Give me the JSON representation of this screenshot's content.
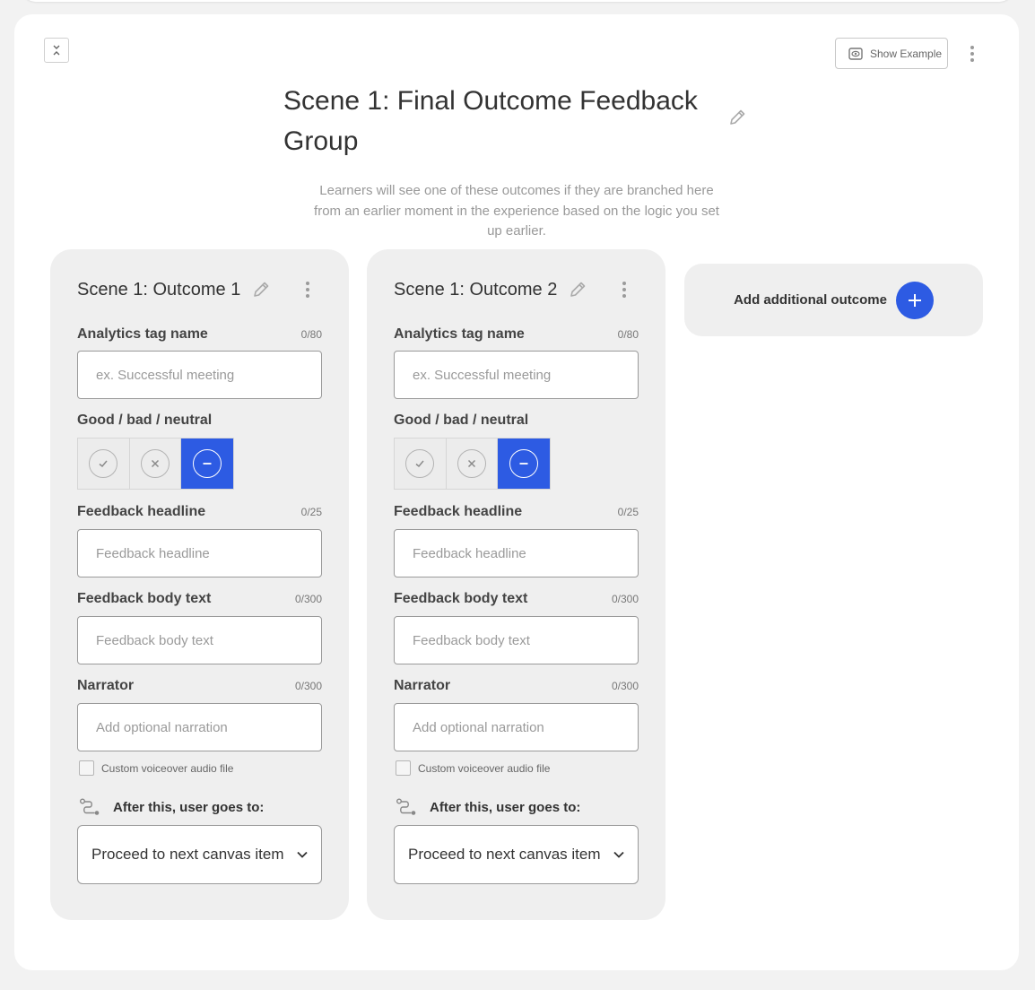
{
  "header": {
    "title": "Scene 1: Final Outcome Feedback Group",
    "description": "Learners will see one of these outcomes if they are branched here from an earlier moment in the experience based on the logic you set up earlier.",
    "show_example_label": "Show Example"
  },
  "outcomes": [
    {
      "title": "Scene 1: Outcome 1",
      "analytics_label": "Analytics tag name",
      "analytics_count": "0/80",
      "analytics_placeholder": "ex. Successful meeting",
      "sentiment_label": "Good / bad / neutral",
      "sentiment_selected": "neutral",
      "headline_label": "Feedback headline",
      "headline_count": "0/25",
      "headline_placeholder": "Feedback headline",
      "body_label": "Feedback body text",
      "body_count": "0/300",
      "body_placeholder": "Feedback body text",
      "narrator_label": "Narrator",
      "narrator_count": "0/300",
      "narrator_placeholder": "Add optional narration",
      "voiceover_label": "Custom voiceover audio file",
      "goes_to_label": "After this, user goes to:",
      "goes_to_value": "Proceed to next canvas item"
    },
    {
      "title": "Scene 1: Outcome 2",
      "analytics_label": "Analytics tag name",
      "analytics_count": "0/80",
      "analytics_placeholder": "ex. Successful meeting",
      "sentiment_label": "Good / bad / neutral",
      "sentiment_selected": "neutral",
      "headline_label": "Feedback headline",
      "headline_count": "0/25",
      "headline_placeholder": "Feedback headline",
      "body_label": "Feedback body text",
      "body_count": "0/300",
      "body_placeholder": "Feedback body text",
      "narrator_label": "Narrator",
      "narrator_count": "0/300",
      "narrator_placeholder": "Add optional narration",
      "voiceover_label": "Custom voiceover audio file",
      "goes_to_label": "After this, user goes to:",
      "goes_to_value": "Proceed to next canvas item"
    }
  ],
  "add_outcome": {
    "label": "Add additional outcome"
  },
  "colors": {
    "accent": "#2d5be3",
    "card_bg": "#efefef",
    "page_bg": "#f2f2f2"
  },
  "icons": [
    "collapse-icon",
    "eye-icon",
    "more-vertical-icon",
    "pencil-icon",
    "check-icon",
    "x-icon",
    "minus-icon",
    "route-icon",
    "chevron-down-icon",
    "plus-icon"
  ]
}
